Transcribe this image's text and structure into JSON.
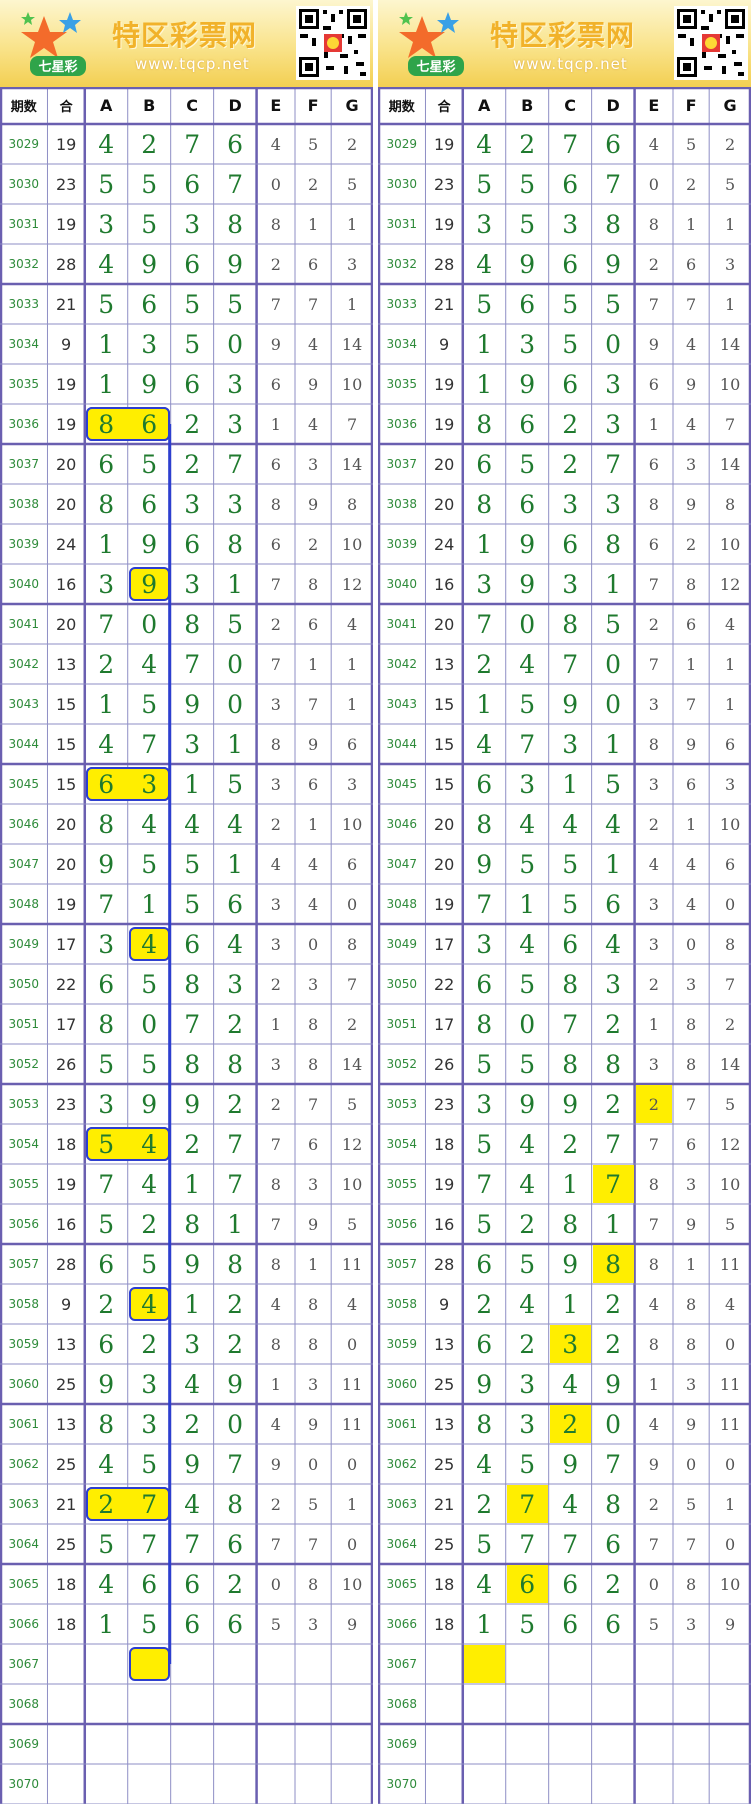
{
  "site": {
    "title": "特区彩票网",
    "url": "www.tqcp.net",
    "logo_text": "七星彩"
  },
  "table": {
    "headers": [
      "期数",
      "合",
      "A",
      "B",
      "C",
      "D",
      "E",
      "F",
      "G"
    ],
    "rows": [
      {
        "issue": "3029",
        "sum": "19",
        "a": "4",
        "b": "2",
        "c": "7",
        "d": "6",
        "e": "4",
        "f": "5",
        "g": "2"
      },
      {
        "issue": "3030",
        "sum": "23",
        "a": "5",
        "b": "5",
        "c": "6",
        "d": "7",
        "e": "0",
        "f": "2",
        "g": "5"
      },
      {
        "issue": "3031",
        "sum": "19",
        "a": "3",
        "b": "5",
        "c": "3",
        "d": "8",
        "e": "8",
        "f": "1",
        "g": "1"
      },
      {
        "issue": "3032",
        "sum": "28",
        "a": "4",
        "b": "9",
        "c": "6",
        "d": "9",
        "e": "2",
        "f": "6",
        "g": "3"
      },
      {
        "issue": "3033",
        "sum": "21",
        "a": "5",
        "b": "6",
        "c": "5",
        "d": "5",
        "e": "7",
        "f": "7",
        "g": "1"
      },
      {
        "issue": "3034",
        "sum": "9",
        "a": "1",
        "b": "3",
        "c": "5",
        "d": "0",
        "e": "9",
        "f": "4",
        "g": "14"
      },
      {
        "issue": "3035",
        "sum": "19",
        "a": "1",
        "b": "9",
        "c": "6",
        "d": "3",
        "e": "6",
        "f": "9",
        "g": "10"
      },
      {
        "issue": "3036",
        "sum": "19",
        "a": "8",
        "b": "6",
        "c": "2",
        "d": "3",
        "e": "1",
        "f": "4",
        "g": "7"
      },
      {
        "issue": "3037",
        "sum": "20",
        "a": "6",
        "b": "5",
        "c": "2",
        "d": "7",
        "e": "6",
        "f": "3",
        "g": "14"
      },
      {
        "issue": "3038",
        "sum": "20",
        "a": "8",
        "b": "6",
        "c": "3",
        "d": "3",
        "e": "8",
        "f": "9",
        "g": "8"
      },
      {
        "issue": "3039",
        "sum": "24",
        "a": "1",
        "b": "9",
        "c": "6",
        "d": "8",
        "e": "6",
        "f": "2",
        "g": "10"
      },
      {
        "issue": "3040",
        "sum": "16",
        "a": "3",
        "b": "9",
        "c": "3",
        "d": "1",
        "e": "7",
        "f": "8",
        "g": "12"
      },
      {
        "issue": "3041",
        "sum": "20",
        "a": "7",
        "b": "0",
        "c": "8",
        "d": "5",
        "e": "2",
        "f": "6",
        "g": "4"
      },
      {
        "issue": "3042",
        "sum": "13",
        "a": "2",
        "b": "4",
        "c": "7",
        "d": "0",
        "e": "7",
        "f": "1",
        "g": "1"
      },
      {
        "issue": "3043",
        "sum": "15",
        "a": "1",
        "b": "5",
        "c": "9",
        "d": "0",
        "e": "3",
        "f": "7",
        "g": "1"
      },
      {
        "issue": "3044",
        "sum": "15",
        "a": "4",
        "b": "7",
        "c": "3",
        "d": "1",
        "e": "8",
        "f": "9",
        "g": "6"
      },
      {
        "issue": "3045",
        "sum": "15",
        "a": "6",
        "b": "3",
        "c": "1",
        "d": "5",
        "e": "3",
        "f": "6",
        "g": "3"
      },
      {
        "issue": "3046",
        "sum": "20",
        "a": "8",
        "b": "4",
        "c": "4",
        "d": "4",
        "e": "2",
        "f": "1",
        "g": "10"
      },
      {
        "issue": "3047",
        "sum": "20",
        "a": "9",
        "b": "5",
        "c": "5",
        "d": "1",
        "e": "4",
        "f": "4",
        "g": "6"
      },
      {
        "issue": "3048",
        "sum": "19",
        "a": "7",
        "b": "1",
        "c": "5",
        "d": "6",
        "e": "3",
        "f": "4",
        "g": "0"
      },
      {
        "issue": "3049",
        "sum": "17",
        "a": "3",
        "b": "4",
        "c": "6",
        "d": "4",
        "e": "3",
        "f": "0",
        "g": "8"
      },
      {
        "issue": "3050",
        "sum": "22",
        "a": "6",
        "b": "5",
        "c": "8",
        "d": "3",
        "e": "2",
        "f": "3",
        "g": "7"
      },
      {
        "issue": "3051",
        "sum": "17",
        "a": "8",
        "b": "0",
        "c": "7",
        "d": "2",
        "e": "1",
        "f": "8",
        "g": "2"
      },
      {
        "issue": "3052",
        "sum": "26",
        "a": "5",
        "b": "5",
        "c": "8",
        "d": "8",
        "e": "3",
        "f": "8",
        "g": "14"
      },
      {
        "issue": "3053",
        "sum": "23",
        "a": "3",
        "b": "9",
        "c": "9",
        "d": "2",
        "e": "2",
        "f": "7",
        "g": "5"
      },
      {
        "issue": "3054",
        "sum": "18",
        "a": "5",
        "b": "4",
        "c": "2",
        "d": "7",
        "e": "7",
        "f": "6",
        "g": "12"
      },
      {
        "issue": "3055",
        "sum": "19",
        "a": "7",
        "b": "4",
        "c": "1",
        "d": "7",
        "e": "8",
        "f": "3",
        "g": "10"
      },
      {
        "issue": "3056",
        "sum": "16",
        "a": "5",
        "b": "2",
        "c": "8",
        "d": "1",
        "e": "7",
        "f": "9",
        "g": "5"
      },
      {
        "issue": "3057",
        "sum": "28",
        "a": "6",
        "b": "5",
        "c": "9",
        "d": "8",
        "e": "8",
        "f": "1",
        "g": "11"
      },
      {
        "issue": "3058",
        "sum": "9",
        "a": "2",
        "b": "4",
        "c": "1",
        "d": "2",
        "e": "4",
        "f": "8",
        "g": "4"
      },
      {
        "issue": "3059",
        "sum": "13",
        "a": "6",
        "b": "2",
        "c": "3",
        "d": "2",
        "e": "8",
        "f": "8",
        "g": "0"
      },
      {
        "issue": "3060",
        "sum": "25",
        "a": "9",
        "b": "3",
        "c": "4",
        "d": "9",
        "e": "1",
        "f": "3",
        "g": "11"
      },
      {
        "issue": "3061",
        "sum": "13",
        "a": "8",
        "b": "3",
        "c": "2",
        "d": "0",
        "e": "4",
        "f": "9",
        "g": "11"
      },
      {
        "issue": "3062",
        "sum": "25",
        "a": "4",
        "b": "5",
        "c": "9",
        "d": "7",
        "e": "9",
        "f": "0",
        "g": "0"
      },
      {
        "issue": "3063",
        "sum": "21",
        "a": "2",
        "b": "7",
        "c": "4",
        "d": "8",
        "e": "2",
        "f": "5",
        "g": "1"
      },
      {
        "issue": "3064",
        "sum": "25",
        "a": "5",
        "b": "7",
        "c": "7",
        "d": "6",
        "e": "7",
        "f": "7",
        "g": "0"
      },
      {
        "issue": "3065",
        "sum": "18",
        "a": "4",
        "b": "6",
        "c": "6",
        "d": "2",
        "e": "0",
        "f": "8",
        "g": "10"
      },
      {
        "issue": "3066",
        "sum": "18",
        "a": "1",
        "b": "5",
        "c": "6",
        "d": "6",
        "e": "5",
        "f": "3",
        "g": "9"
      },
      {
        "issue": "3067",
        "sum": "",
        "a": "",
        "b": "",
        "c": "",
        "d": "",
        "e": "",
        "f": "",
        "g": ""
      },
      {
        "issue": "3068",
        "sum": "",
        "a": "",
        "b": "",
        "c": "",
        "d": "",
        "e": "",
        "f": "",
        "g": ""
      },
      {
        "issue": "3069",
        "sum": "",
        "a": "",
        "b": "",
        "c": "",
        "d": "",
        "e": "",
        "f": "",
        "g": ""
      },
      {
        "issue": "3070",
        "sum": "",
        "a": "",
        "b": "",
        "c": "",
        "d": "",
        "e": "",
        "f": "",
        "g": ""
      }
    ]
  },
  "highlights": {
    "left_box_cells": [
      [
        "3036",
        "a"
      ],
      [
        "3036",
        "b"
      ],
      [
        "3040",
        "b"
      ],
      [
        "3045",
        "a"
      ],
      [
        "3045",
        "b"
      ],
      [
        "3049",
        "b"
      ],
      [
        "3054",
        "a"
      ],
      [
        "3054",
        "b"
      ],
      [
        "3058",
        "b"
      ],
      [
        "3063",
        "a"
      ],
      [
        "3063",
        "b"
      ],
      [
        "3067",
        "b"
      ]
    ],
    "left_trend_line": {
      "column": "b",
      "from": "3036",
      "to": "3067"
    },
    "right_yellow_cells": [
      [
        "3053",
        "e"
      ],
      [
        "3055",
        "d"
      ],
      [
        "3057",
        "d"
      ],
      [
        "3059",
        "c"
      ],
      [
        "3061",
        "c"
      ],
      [
        "3063",
        "b"
      ],
      [
        "3065",
        "b"
      ],
      [
        "3067",
        "a"
      ]
    ]
  },
  "colors": {
    "header_banner": "#f9e38a",
    "grid_line": "#8e8ec5",
    "group_line": "#6a5fb0",
    "issue_text": "#2e8b3a",
    "main_digit": "#1f7a2e",
    "highlight": "#ffee00",
    "trend_line": "#2d3fcf"
  }
}
